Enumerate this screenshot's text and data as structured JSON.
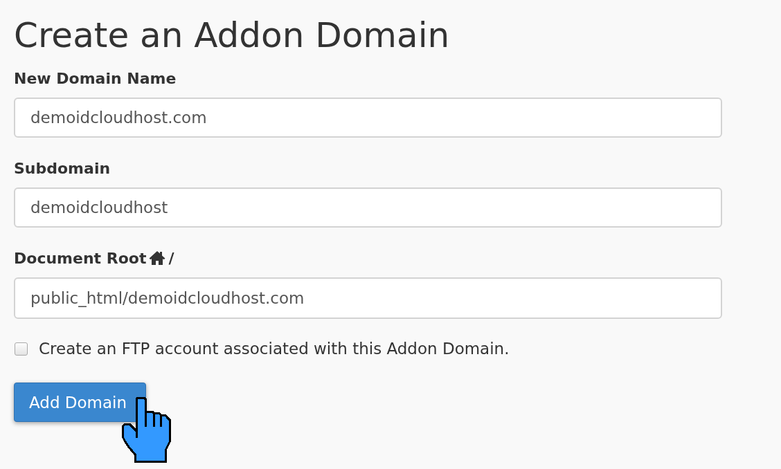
{
  "title": "Create an Addon Domain",
  "fields": [
    {
      "kind": "text",
      "label": "New Domain Name",
      "value": "demoidcloudhost.com"
    },
    {
      "kind": "text",
      "label": "Subdomain",
      "value": "demoidcloudhost"
    },
    {
      "kind": "path",
      "label": "Document Root",
      "path_separator": "/",
      "value": "public_html/demoidcloudhost.com"
    }
  ],
  "ftp_option": {
    "label": "Create an FTP account associated with this Addon Domain.",
    "checked": false
  },
  "submit_button": {
    "label": "Add Domain"
  }
}
